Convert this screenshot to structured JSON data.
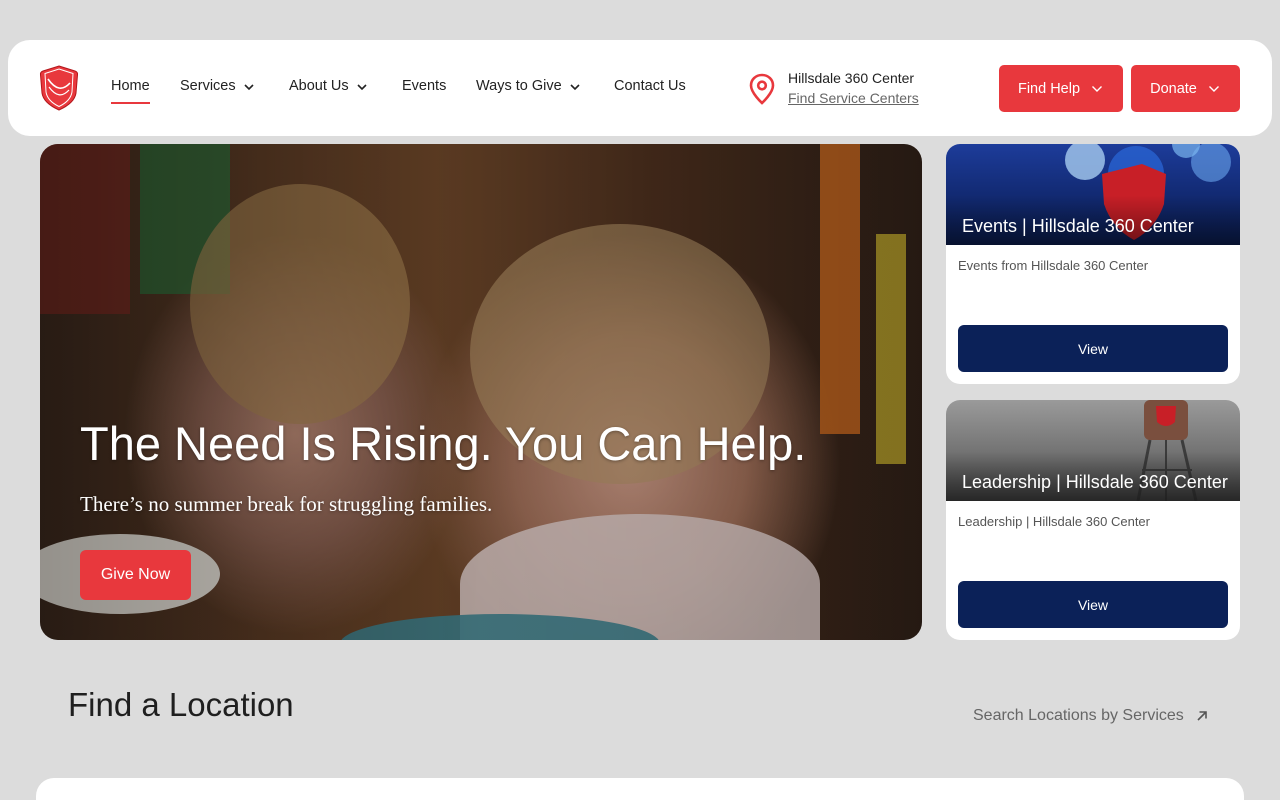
{
  "header": {
    "nav": [
      {
        "label": "Home",
        "dropdown": false,
        "active": true
      },
      {
        "label": "Services",
        "dropdown": true
      },
      {
        "label": "About Us",
        "dropdown": true
      },
      {
        "label": "Events",
        "dropdown": false
      },
      {
        "label": "Ways to Give",
        "dropdown": true
      },
      {
        "label": "Contact Us",
        "dropdown": false
      }
    ],
    "location": {
      "name": "Hillsdale 360 Center",
      "link": "Find Service Centers"
    },
    "find_help_label": "Find Help",
    "donate_label": "Donate"
  },
  "hero": {
    "title": "The Need Is Rising. You Can Help.",
    "subtitle": "There’s no summer break for struggling families.",
    "button_label": "Give Now"
  },
  "cards": [
    {
      "image_title": "Events | Hillsdale 360 Center",
      "description": "Events from Hillsdale 360 Center",
      "button_label": "View"
    },
    {
      "image_title": "Leadership | Hillsdale 360 Center",
      "description": "Leadership | Hillsdale 360 Center",
      "button_label": "View"
    }
  ],
  "find_location": {
    "title": "Find a Location",
    "link_label": "Search Locations by Services"
  },
  "colors": {
    "brand_red": "#e8383d",
    "navy": "#0b2158",
    "page_bg": "#dcdcdc"
  },
  "icons": [
    "salvation-army-shield-logo",
    "chevron-down-icon",
    "map-pin-icon",
    "arrow-up-right-icon"
  ]
}
